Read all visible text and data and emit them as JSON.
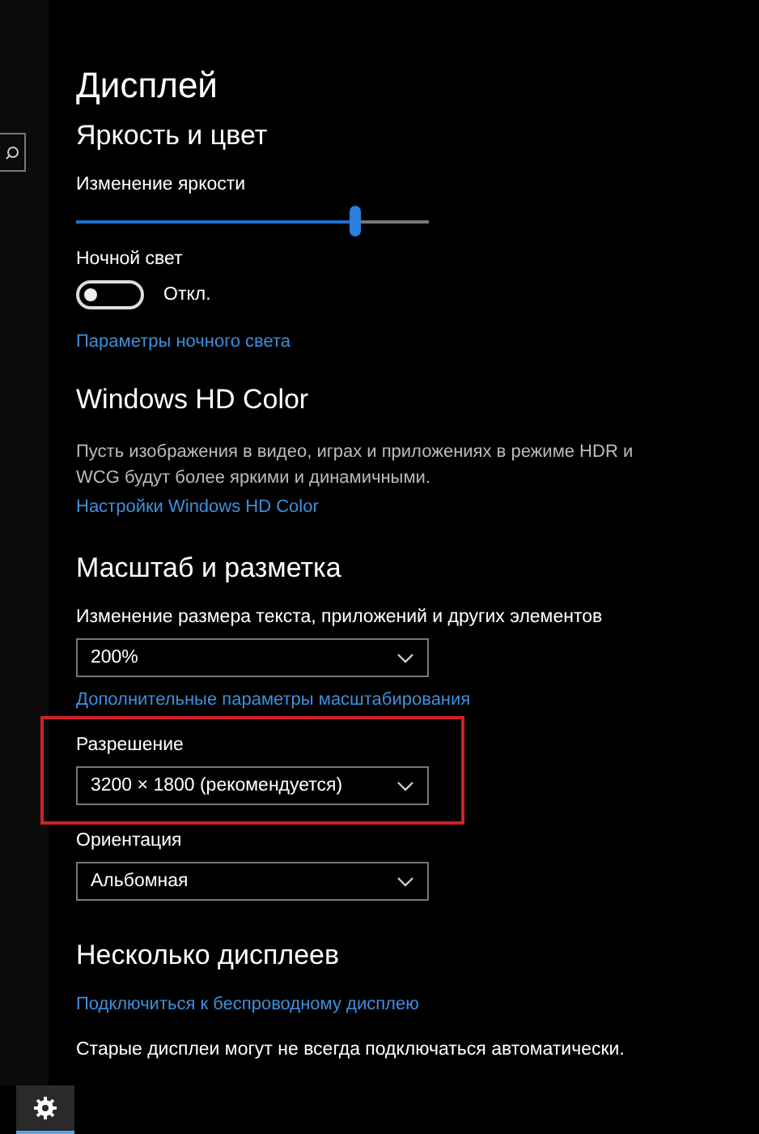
{
  "title": "Дисплей",
  "brightness": {
    "heading": "Яркость и цвет",
    "label": "Изменение яркости",
    "level": 0.79
  },
  "night_light": {
    "label": "Ночной свет",
    "on": false,
    "state_text": "Откл.",
    "link": "Параметры ночного света"
  },
  "hd_color": {
    "heading": "Windows HD Color",
    "description": "Пусть изображения в видео, играх и приложениях в режиме HDR и WCG будут более яркими и динамичными.",
    "link": "Настройки Windows HD Color"
  },
  "scale": {
    "heading": "Масштаб и разметка",
    "dropdowns": [
      {
        "label": "Изменение размера текста, приложений и других элементов",
        "value": "200%",
        "highlighted": false
      }
    ],
    "link": "Дополнительные параметры масштабирования",
    "more_dropdowns": [
      {
        "label": "Разрешение",
        "value": "3200 × 1800 (рекомендуется)",
        "highlighted": true
      },
      {
        "label": "Ориентация",
        "value": "Альбомная",
        "highlighted": false
      }
    ]
  },
  "multiple_displays": {
    "heading": "Несколько дисплеев",
    "link": "Подключиться к беспроводному дисплею",
    "note": "Старые дисплеи могут не всегда подключаться автоматически."
  },
  "taskbar": {
    "settings_selected": true
  }
}
